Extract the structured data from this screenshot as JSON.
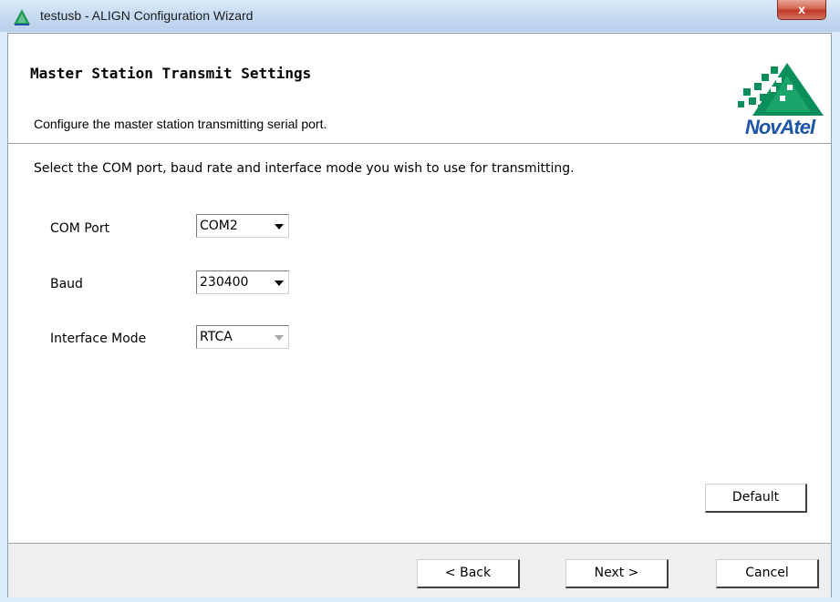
{
  "window": {
    "title": "testusb - ALIGN Configuration Wizard",
    "close_label": "x"
  },
  "header": {
    "title": "Master Station Transmit Settings",
    "subtitle": "Configure the master station transmitting serial port.",
    "logo_text": "NovAtel"
  },
  "main": {
    "instruction": "Select the COM port, baud rate and interface mode you wish to use for transmitting.",
    "fields": {
      "com_port": {
        "label": "COM Port",
        "value": "COM2"
      },
      "baud": {
        "label": "Baud",
        "value": "230400"
      },
      "interface_mode": {
        "label": "Interface Mode",
        "value": "RTCA",
        "disabled": true
      }
    },
    "default_label": "Default"
  },
  "footer": {
    "back_label": "< Back",
    "next_label": "Next >",
    "cancel_label": "Cancel"
  },
  "colors": {
    "logo_green": "#0a8f5a",
    "logo_blue": "#1a55a8",
    "close_red": "#c0392b"
  }
}
